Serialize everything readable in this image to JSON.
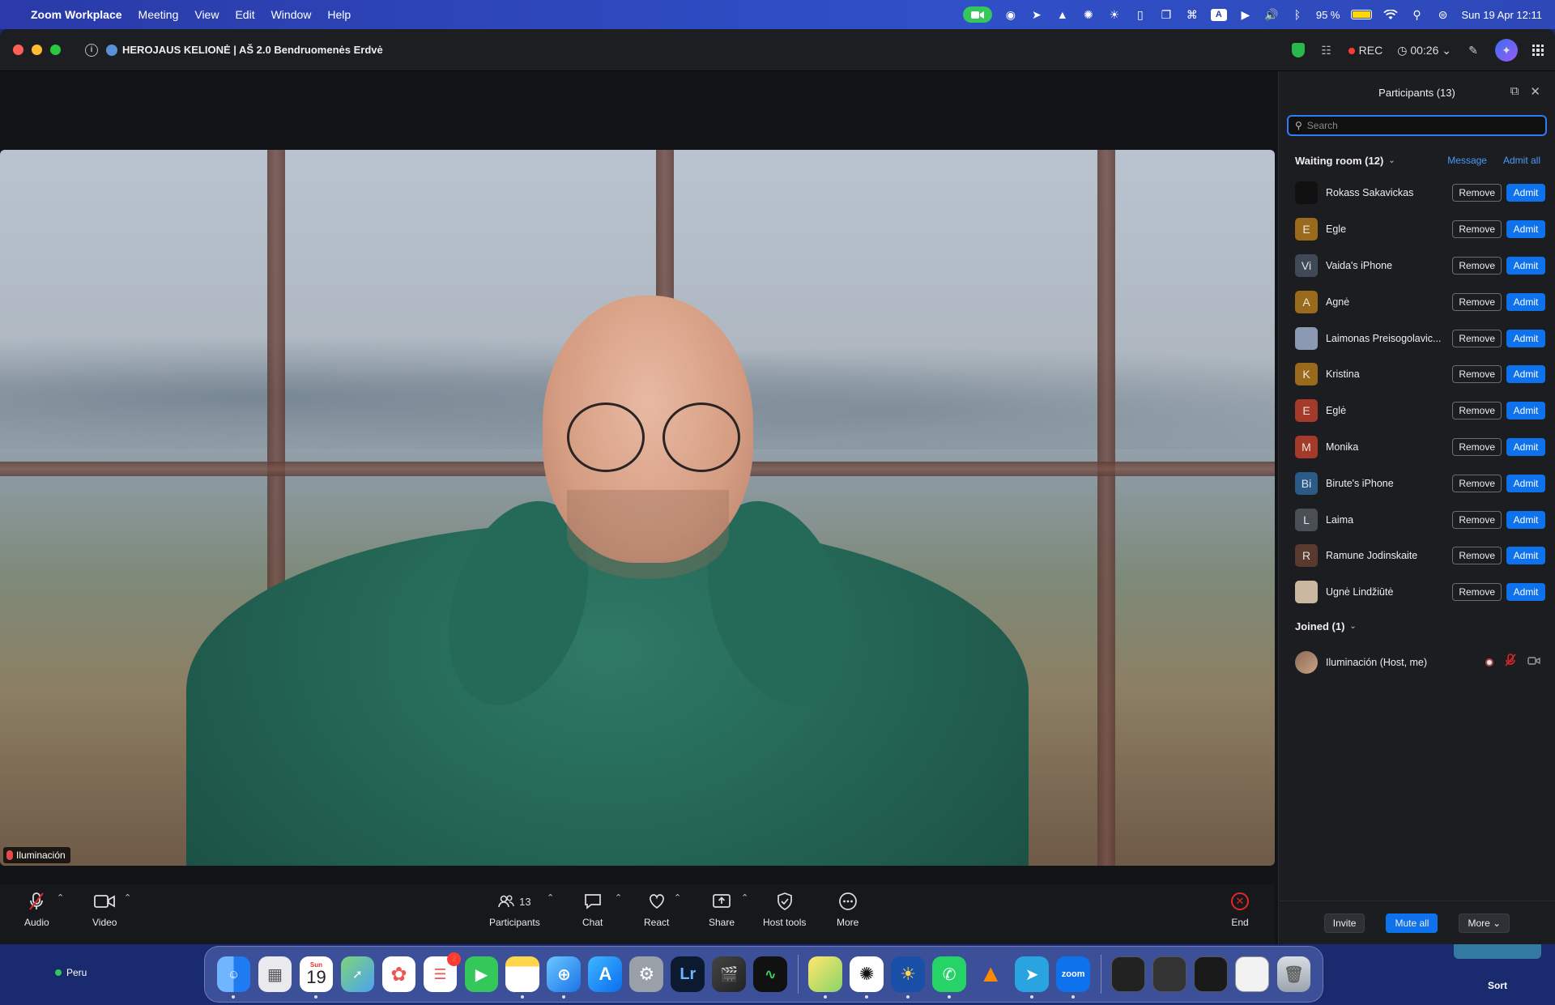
{
  "menubar": {
    "app_name": "Zoom Workplace",
    "menus": [
      "Meeting",
      "View",
      "Edit",
      "Window",
      "Help"
    ],
    "battery": "95 %",
    "datetime": "Sun 19 Apr  12:11"
  },
  "titlebar": {
    "title": "HEROJAUS KELIONĖ | AŠ 2.0 Bendruomenės Erdvė",
    "rec_label": "REC",
    "timer": "00:26"
  },
  "video": {
    "name_tag": "Iluminación"
  },
  "toolbar": {
    "audio": "Audio",
    "video": "Video",
    "participants": "Participants",
    "participants_count": "13",
    "chat": "Chat",
    "react": "React",
    "share": "Share",
    "host_tools": "Host tools",
    "more": "More",
    "end": "End"
  },
  "panel": {
    "title": "Participants (13)",
    "search_placeholder": "Search",
    "waiting_header": "Waiting room (12)",
    "message_link": "Message",
    "admit_all_link": "Admit all",
    "remove_label": "Remove",
    "admit_label": "Admit",
    "waiting": [
      {
        "name": "Rokass Sakavickas",
        "initial": "",
        "color": "#111111"
      },
      {
        "name": "Egle",
        "initial": "E",
        "color": "#9a6a1c"
      },
      {
        "name": "Vaida's iPhone",
        "initial": "Vi",
        "color": "#3f4a56"
      },
      {
        "name": "Agnė",
        "initial": "A",
        "color": "#9a6a1c"
      },
      {
        "name": "Laimonas Preisogolavic...",
        "initial": "",
        "color": "#8c99b3"
      },
      {
        "name": "Kristina",
        "initial": "K",
        "color": "#9a6a1c"
      },
      {
        "name": "Eglė",
        "initial": "E",
        "color": "#a33a2a"
      },
      {
        "name": "Monika",
        "initial": "M",
        "color": "#a33a2a"
      },
      {
        "name": "Birute's iPhone",
        "initial": "Bi",
        "color": "#2a5a86"
      },
      {
        "name": "Laima",
        "initial": "L",
        "color": "#4a4e55"
      },
      {
        "name": "Ramune Jodinskaite",
        "initial": "R",
        "color": "#5a3a2e"
      },
      {
        "name": "Ugnė Lindžiūtė",
        "initial": "",
        "color": "#c9b89f"
      }
    ],
    "joined_header": "Joined (1)",
    "joined": [
      {
        "name": "Iluminación (Host, me)"
      }
    ],
    "footer": {
      "invite": "Invite",
      "mute_all": "Mute all",
      "more": "More"
    }
  },
  "desktop": {
    "left_label": "Peru",
    "sort_label": "Sort"
  },
  "dock": {
    "calendar_day": "19",
    "calendar_month": "Sun",
    "reminders_badge": "2",
    "lightroom": "Lr",
    "zoom_label": "zoom"
  }
}
